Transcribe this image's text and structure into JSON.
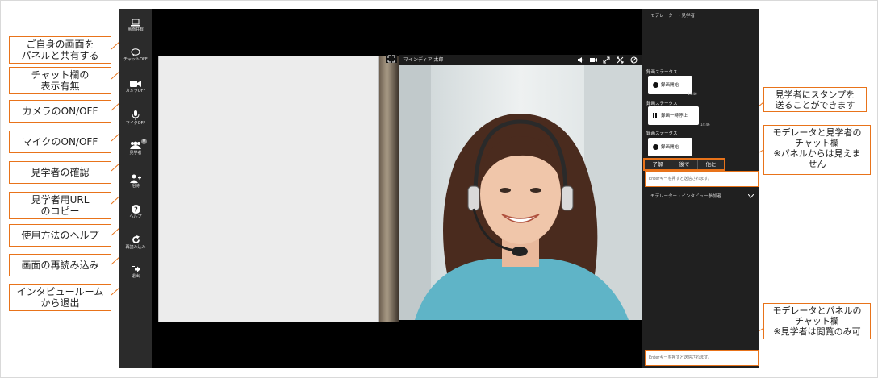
{
  "toolbar": {
    "items": [
      {
        "label": "画面共有",
        "icon": "laptop-icon"
      },
      {
        "label": "チャットOFF",
        "icon": "chat-icon"
      },
      {
        "label": "カメラOFF",
        "icon": "video-camera-icon"
      },
      {
        "label": "マイクOFF",
        "icon": "microphone-icon"
      },
      {
        "label": "見学者",
        "icon": "users-icon",
        "badge": "0"
      },
      {
        "label": "招待",
        "icon": "add-user-icon"
      },
      {
        "label": "ヘルプ",
        "icon": "help-icon"
      },
      {
        "label": "再読み込み",
        "icon": "reload-icon"
      },
      {
        "label": "退出",
        "icon": "exit-icon"
      }
    ]
  },
  "callouts": [
    {
      "text": "ご自身の画面を\nパネルと共有する"
    },
    {
      "text": "チャット欄の\n表示有無"
    },
    {
      "text": "カメラのON/OFF"
    },
    {
      "text": "マイクのON/OFF"
    },
    {
      "text": "見学者の確認"
    },
    {
      "text": "見学者用URL\nのコピー"
    },
    {
      "text": "使用方法のヘルプ"
    },
    {
      "text": "画面の再読み込み"
    },
    {
      "text": "インタビュールーム\nから退出"
    }
  ],
  "video": {
    "participant_name": "マインディア 太郎"
  },
  "side": {
    "observer_header": "モデレーター・見学者",
    "panel_header": "モデレーター・インタビュー参加者",
    "status_entries": [
      {
        "label": "録画ステータス",
        "button": "録画開始",
        "time": "14:46"
      },
      {
        "label": "録画ステータス",
        "button": "録画一時停止",
        "time": "14:46"
      },
      {
        "label": "録画ステータス",
        "button": "録画開始",
        "time": ""
      }
    ],
    "stamps": [
      "了解",
      "後で",
      "他に"
    ],
    "chat_placeholder": "Enterキーを押すと送信されます。"
  },
  "right_callouts": {
    "stamp_note": "見学者にスタンプを\n送ることができます",
    "observer_chat_note": "モデレータと見学者の\nチャット欄\n※パネルからは見えま\nせん",
    "panel_chat_note": "モデレータとパネルの\nチャット欄\n※見学者は閲覧のみ可"
  },
  "colors": {
    "accent": "#e8731a",
    "toolbar": "#2b2b2b",
    "stage": "#000000",
    "side": "#202020"
  }
}
